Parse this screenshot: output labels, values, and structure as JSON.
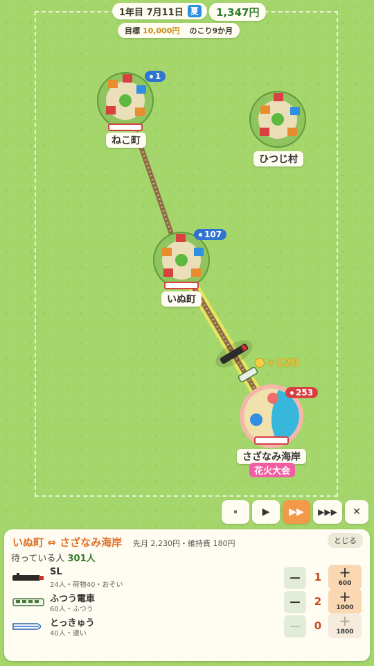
{
  "hud": {
    "date": "1年目 7月11日",
    "season": "夏",
    "money": "1,347円",
    "goal_label": "目標",
    "goal_amount": "10,000円",
    "remaining": "のこり9か月"
  },
  "map": {
    "towns": [
      {
        "name": "ねこ町",
        "waiting": "1",
        "badge_color": "#2f74d0"
      },
      {
        "name": "ひつじ村",
        "waiting": "",
        "badge_color": ""
      },
      {
        "name": "いぬ町",
        "waiting": "107",
        "badge_color": "#2f74d0"
      },
      {
        "name": "さざなみ海岸",
        "waiting": "253",
        "badge_color": "#d94040",
        "event": "花火大会"
      }
    ],
    "coin_popup": "+120"
  },
  "controls": {
    "pause": "⏸",
    "play": "▶",
    "fast": "▶▶",
    "faster": "▶▶▶",
    "close": "✕",
    "active": "fast"
  },
  "panel": {
    "route_from": "いぬ町",
    "route_arrow": "⇔",
    "route_to": "さざなみ海岸",
    "cost_text": "先月 2,230円・維持費 180円",
    "close_label": "とじる",
    "waiting_prefix": "待っている人",
    "waiting_count": "301人",
    "trains": [
      {
        "name": "SL",
        "desc": "24人・荷物40・おそい",
        "minus": "－",
        "count": "1",
        "plus": "＋",
        "price": "600",
        "icon": "steam-locomotive-icon"
      },
      {
        "name": "ふつう電車",
        "desc": "60人・ふつう",
        "minus": "－",
        "count": "2",
        "plus": "＋",
        "price": "1000",
        "icon": "local-train-icon"
      },
      {
        "name": "とっきゅう",
        "desc": "40人・速い",
        "minus": "－",
        "count": "0",
        "plus": "＋",
        "price": "1800",
        "icon": "express-train-icon"
      }
    ]
  },
  "colors": {
    "grass": "#a4d66c",
    "accent_orange": "#e0702a",
    "money_green": "#2e7a2a",
    "event_pink": "#f35ca3"
  }
}
